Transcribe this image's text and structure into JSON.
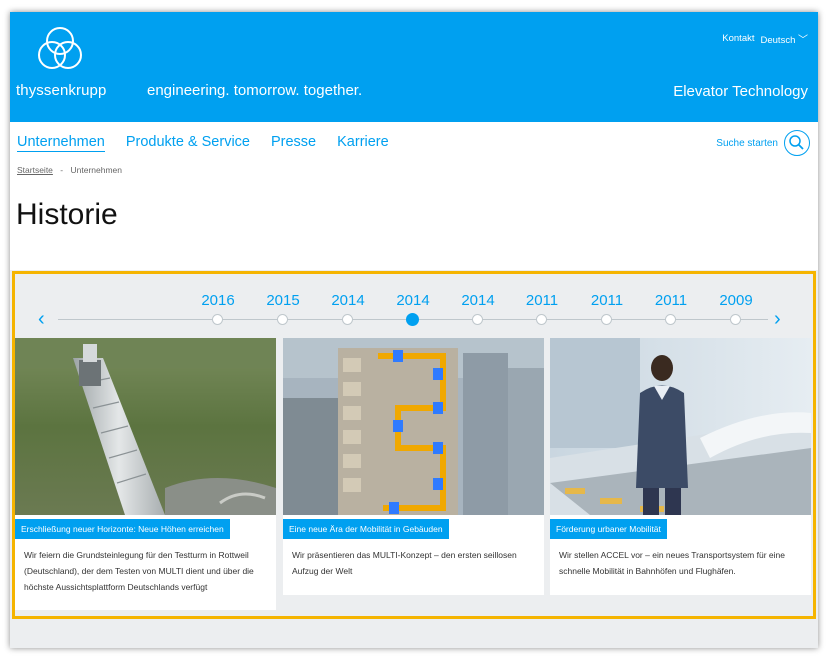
{
  "header": {
    "brand": "thyssenkrupp",
    "slogan": "engineering. tomorrow. together.",
    "unit": "Elevator Technology",
    "meta": {
      "contact": "Kontakt",
      "language": "Deutsch"
    },
    "colors": {
      "brand_blue": "#00a0f0",
      "highlight": "#f5b400"
    }
  },
  "nav": {
    "items": [
      "Unternehmen",
      "Produkte & Service",
      "Presse",
      "Karriere"
    ],
    "active": "Unternehmen",
    "search_label": "Suche starten"
  },
  "breadcrumb": {
    "home": "Startseite",
    "current": "Unternehmen"
  },
  "page": {
    "title": "Historie"
  },
  "timeline": {
    "years": [
      "2016",
      "2015",
      "2014",
      "2014",
      "2014",
      "2011",
      "2011",
      "2011",
      "2009"
    ],
    "active_index": 3
  },
  "cards": [
    {
      "tag": "Erschließung neuer Horizonte: Neue Höhen erreichen",
      "text": "Wir feiern die Grundsteinlegung für den Testturm in Rottweil (Deutschland), der dem Testen von MULTI dient und über die höchste Aussichtsplattform Deutschlands verfügt"
    },
    {
      "tag": "Eine neue Ära der Mobilität in Gebäuden",
      "text": "Wir präsentieren das MULTI-Konzept – den ersten seillosen Aufzug der Welt"
    },
    {
      "tag": "Förderung urbaner Mobilität",
      "text": "Wir stellen ACCEL vor – ein neues Transportsystem für eine schnelle Mobilität in Bahnhöfen und Flughäfen."
    }
  ]
}
